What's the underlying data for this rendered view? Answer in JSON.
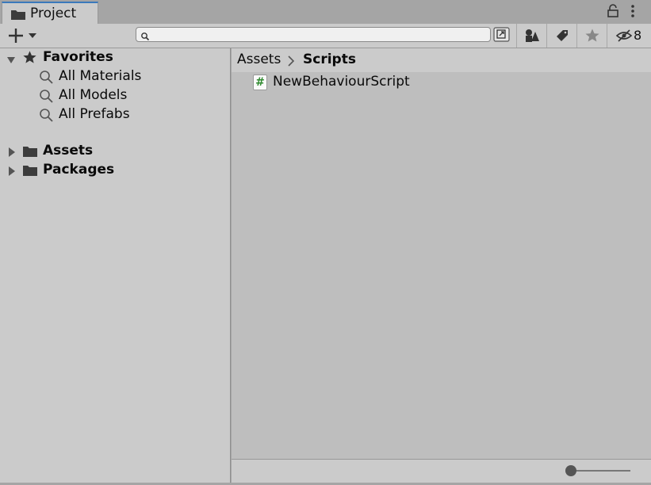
{
  "window": {
    "tab_label": "Project",
    "icons": [
      "folder-icon",
      "lock-icon",
      "kebab-menu-icon"
    ]
  },
  "toolbar": {
    "create_icon": "plus-icon",
    "search": {
      "value": "",
      "placeholder": ""
    },
    "filter_buttons": [
      "search-by-type-icon",
      "search-by-label-icon",
      "favorites-star-icon",
      "hidden-packages-eye-icon"
    ],
    "hidden_packages_count": "8"
  },
  "favorites": {
    "label": "Favorites",
    "items": [
      {
        "label": "All Materials"
      },
      {
        "label": "All Models"
      },
      {
        "label": "All Prefabs"
      }
    ]
  },
  "folders": [
    {
      "label": "Assets"
    },
    {
      "label": "Packages"
    }
  ],
  "breadcrumb": {
    "parent": "Assets",
    "current": "Scripts"
  },
  "assets": [
    {
      "label": "NewBehaviourScript",
      "icon": "csharp-script-icon",
      "glyph": "#"
    }
  ],
  "colors": {
    "tab_accent": "#3a79bb",
    "panel_bg": "#cbcbcb",
    "content_bg": "#bebebe",
    "script_hash": "#2f8a2f"
  }
}
